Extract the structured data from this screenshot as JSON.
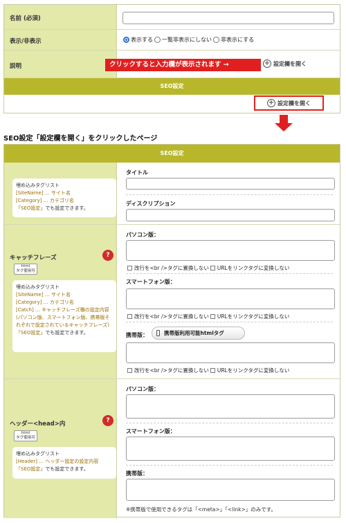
{
  "top_form": {
    "name_label": "名前 (必須)",
    "display_label": "表示/非表示",
    "radio_1": "表示する",
    "radio_2": "一覧非表示にしない",
    "radio_3": "非表示にする",
    "desc_label": "説明",
    "callout": "クリックすると入力欄が表示されます →",
    "open_settings": "設定欄を開く",
    "seo_bar": "SEO設定",
    "open_settings_2": "設定欄を開く"
  },
  "caption": "SEO設定「設定欄を開く」をクリックしたページ",
  "seo_panel": {
    "header": "SEO設定",
    "embed_title": "埋め込みタグリスト",
    "row1": {
      "tags": [
        "[SiteName] … サイト名",
        "[Category] … カテゴリ名"
      ],
      "note_link": "「SEO設定」",
      "note_rest": "でも設定できます。",
      "title_label": "タイトル",
      "desc_label": "ディスクリプション"
    },
    "row2": {
      "label": "キャッチフレーズ",
      "help": "?",
      "html_icon_1": "html",
      "html_icon_2": "タグ使用可",
      "tags": [
        "[SiteName] … サイト名",
        "[Category] … カテゴリ名"
      ],
      "catch_tag": "[Catch] … キャッチフレーズ欄の設定内容",
      "catch_desc": "(パソコン版、スマートフォン版、携帯版それぞれで設定されているキャッチフレーズ)",
      "note_link": "「SEO設定」",
      "note_rest": "でも設定できます。",
      "pc_label": "パソコン版：",
      "sp_label": "スマートフォン版：",
      "mobile_label": "携帯版：",
      "mobile_tag_btn": "携帯版利用可能htmlタグ",
      "chk_br": "改行を<br />タグに置換しない",
      "chk_url": "URLをリンクタグに変換しない"
    },
    "row3": {
      "label": "ヘッダー<head>内",
      "help": "?",
      "html_icon_1": "html",
      "html_icon_2": "タグ使用可",
      "header_tag": "[Header] … ヘッダー設定の設定内容",
      "note_link": "「SEO設定」",
      "note_rest": "でも設定できます。",
      "pc_label": "パソコン版：",
      "sp_label": "スマートフォン版：",
      "mobile_label": "携帯版：",
      "mobile_note": "※携帯版で使用できるタグは「<meta>」「<link>」のみです。"
    }
  }
}
